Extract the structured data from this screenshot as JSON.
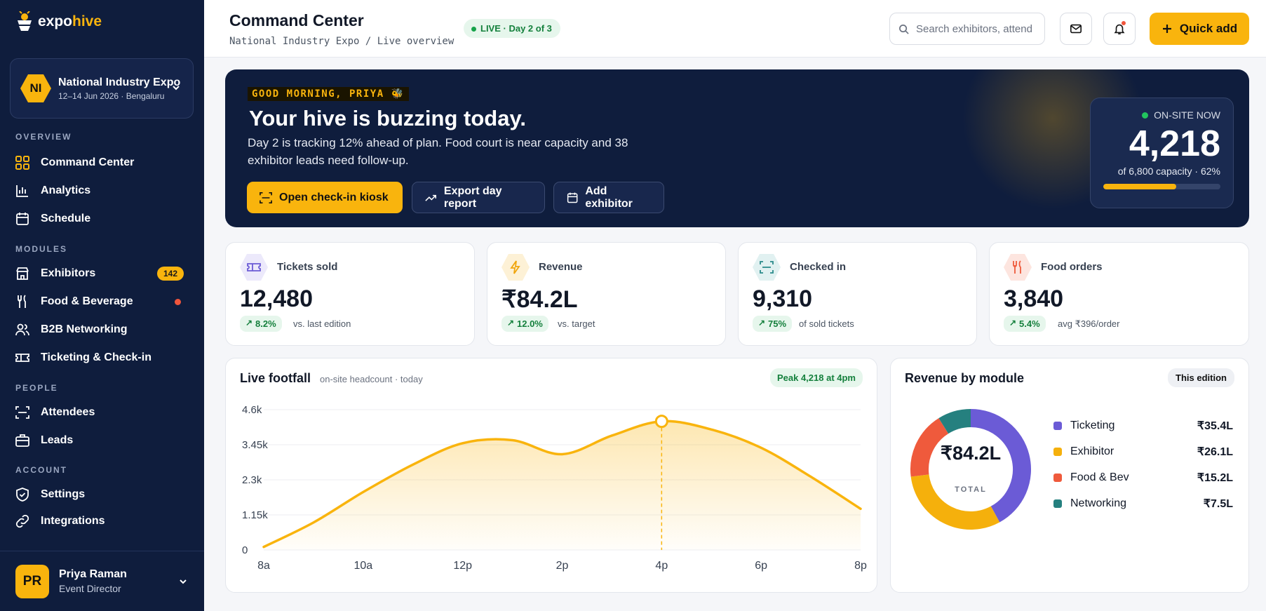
{
  "brand": {
    "part1": "expo",
    "part2": "hive"
  },
  "event": {
    "initials": "NI",
    "name": "National Industry Expo",
    "dates": "12–14 Jun 2026 · Bengaluru"
  },
  "sidebar": {
    "sections": [
      "OVERVIEW",
      "MODULES",
      "PEOPLE",
      "ACCOUNT"
    ],
    "items": [
      {
        "label": "Command Center",
        "icon": "grid-icon",
        "active": true
      },
      {
        "label": "Analytics",
        "icon": "bar-chart-icon"
      },
      {
        "label": "Schedule",
        "icon": "calendar-icon"
      },
      {
        "label": "Exhibitors",
        "icon": "store-icon",
        "badge": "142"
      },
      {
        "label": "Food & Beverage",
        "icon": "utensils-icon",
        "dot": true
      },
      {
        "label": "B2B Networking",
        "icon": "people-icon"
      },
      {
        "label": "Ticketing & Check-in",
        "icon": "ticket-icon"
      },
      {
        "label": "Attendees",
        "icon": "scan-icon"
      },
      {
        "label": "Leads",
        "icon": "briefcase-icon"
      },
      {
        "label": "Settings",
        "icon": "shield-icon"
      },
      {
        "label": "Integrations",
        "icon": "link-icon"
      }
    ]
  },
  "user": {
    "initials": "PR",
    "name": "Priya Raman",
    "role": "Event Director"
  },
  "header": {
    "title": "Command Center",
    "breadcrumb": "National Industry Expo / Live overview",
    "live": "LIVE · Day 2 of 3",
    "search_placeholder": "Search exhibitors, attend",
    "quick_add": "Quick add"
  },
  "hero": {
    "greeting": "GOOD MORNING, PRIYA 🐝",
    "headline": "Your hive is buzzing today.",
    "message": "Day 2 is tracking 12% ahead of plan. Food court is near capacity and 38 exhibitor leads need follow-up.",
    "btn_kiosk": "Open check-in kiosk",
    "btn_export": "Export day report",
    "btn_add": "Add exhibitor",
    "onsite_label": "ON-SITE NOW",
    "onsite_value": "4,218",
    "onsite_capacity": "of 6,800 capacity · 62%",
    "onsite_fill": 0.62
  },
  "stats": [
    {
      "label": "Tickets sold",
      "value": "12,480",
      "change": "8.2%",
      "compare": "vs. last edition",
      "icon": "ticket-icon",
      "tint": "#ece9fb",
      "color": "#6b5bd6"
    },
    {
      "label": "Revenue",
      "value": "₹84.2L",
      "change": "12.0%",
      "compare": "vs. target",
      "icon": "bolt-icon",
      "tint": "#fdf1d6",
      "color": "#f0a50c"
    },
    {
      "label": "Checked in",
      "value": "9,310",
      "change": "75%",
      "compare": "of sold tickets",
      "icon": "scan-icon",
      "tint": "#e1f1f1",
      "color": "#2a8a8a"
    },
    {
      "label": "Food orders",
      "value": "3,840",
      "change": "5.4%",
      "compare": "avg ₹396/order",
      "icon": "utensils-icon",
      "tint": "#fde5df",
      "color": "#ef5a3c"
    }
  ],
  "footfall": {
    "title": "Live footfall",
    "subtitle": "on-site headcount · today",
    "peak": "Peak 4,218 at 4pm"
  },
  "revenue": {
    "title": "Revenue by module",
    "pill": "This edition",
    "total": "₹84.2L",
    "total_label": "TOTAL"
  },
  "chart_data": [
    {
      "type": "area",
      "title": "Live footfall",
      "x": [
        "8a",
        "9a",
        "10a",
        "11a",
        "12p",
        "1p",
        "2p",
        "3p",
        "4p",
        "5p",
        "6p",
        "7p",
        "8p"
      ],
      "x_ticks": [
        "8a",
        "10a",
        "12p",
        "2p",
        "4p",
        "6p",
        "8p"
      ],
      "y_ticks": [
        "0",
        "1.15k",
        "2.3k",
        "3.45k",
        "4.6k"
      ],
      "ylim": [
        0,
        4600
      ],
      "values": [
        100,
        900,
        1900,
        2800,
        3500,
        3600,
        3140,
        3750,
        4218,
        3950,
        3350,
        2400,
        1350
      ],
      "peak_index": 8,
      "color": "#f9b40d"
    },
    {
      "type": "pie",
      "title": "Revenue by module",
      "categories": [
        "Ticketing",
        "Exhibitor",
        "Food & Bev",
        "Networking"
      ],
      "values": [
        35.4,
        26.1,
        15.2,
        7.5
      ],
      "labels": [
        "₹35.4L",
        "₹26.1L",
        "₹15.2L",
        "₹7.5L"
      ],
      "colors": [
        "#6b5bd6",
        "#f5b00c",
        "#ef5a3c",
        "#25807f"
      ]
    }
  ]
}
